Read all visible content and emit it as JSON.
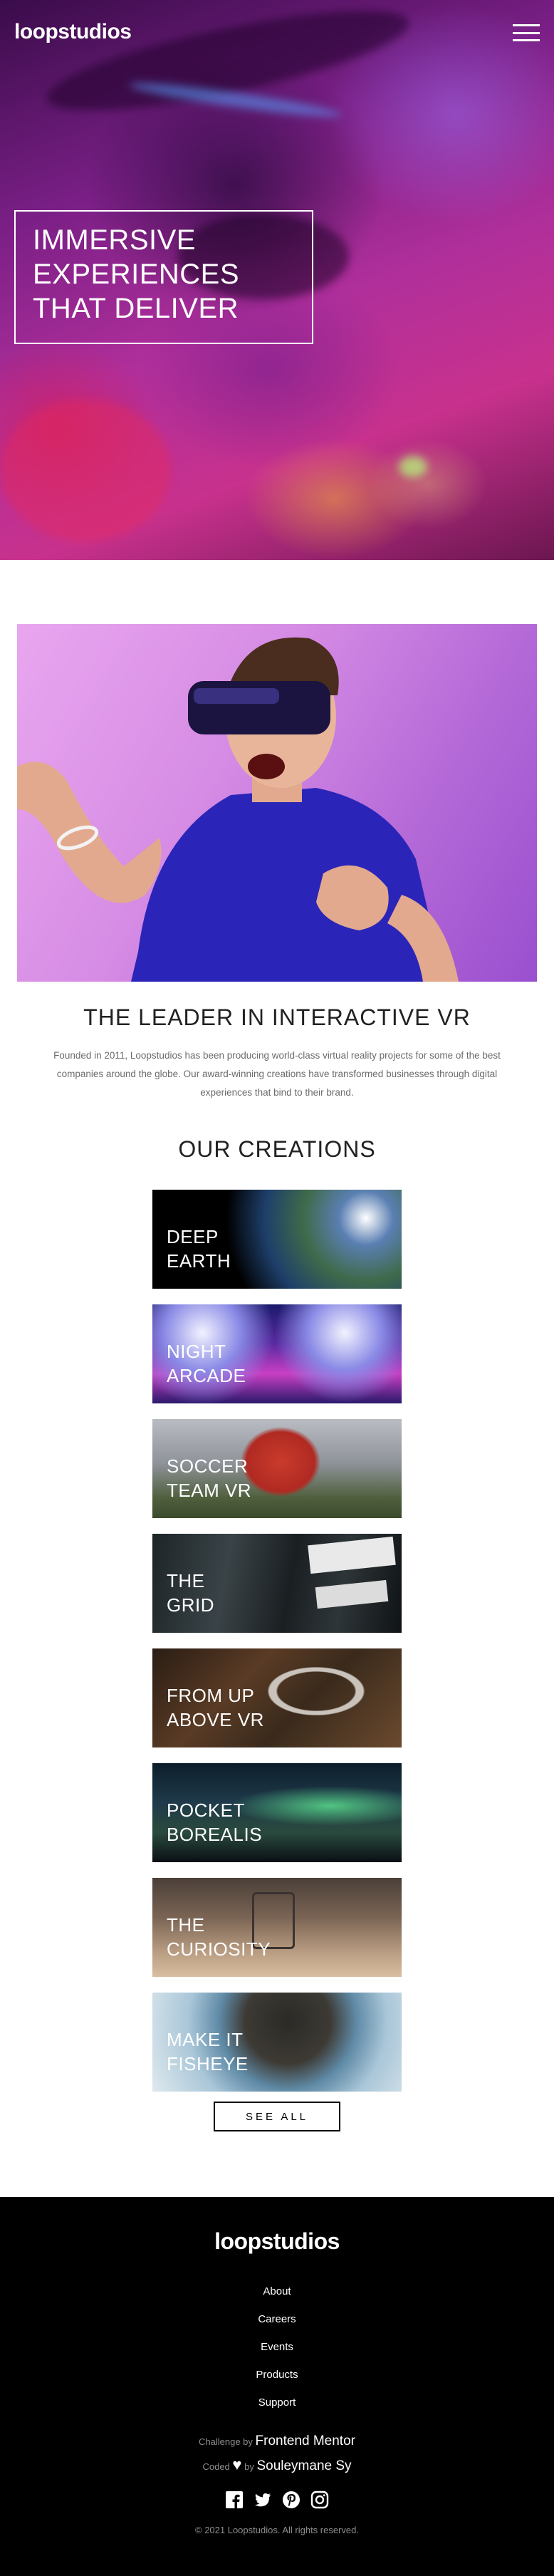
{
  "header": {
    "logo": "loopstudios",
    "menu_icon": "hamburger-menu-icon"
  },
  "hero": {
    "title": "IMMERSIVE\nEXPERIENCES\nTHAT DELIVER"
  },
  "intro": {
    "heading": "THE LEADER IN INTERACTIVE VR",
    "text": "Founded in 2011, Loopstudios has been producing world-class virtual reality projects for some of the best companies around the globe. Our award-winning creations have transformed businesses through digital experiences that bind to their brand."
  },
  "creations": {
    "heading": "OUR CREATIONS",
    "items": [
      {
        "title": "DEEP\nEARTH"
      },
      {
        "title": "NIGHT\nARCADE"
      },
      {
        "title": "SOCCER\nTEAM VR"
      },
      {
        "title": "THE\nGRID"
      },
      {
        "title": "FROM UP\nABOVE VR"
      },
      {
        "title": "POCKET\nBOREALIS"
      },
      {
        "title": "THE\nCURIOSITY"
      },
      {
        "title": "MAKE IT\nFISHEYE"
      }
    ],
    "see_all": "SEE ALL"
  },
  "footer": {
    "logo": "loopstudios",
    "nav": [
      "About",
      "Careers",
      "Events",
      "Products",
      "Support"
    ],
    "challenge_prefix": "Challenge by",
    "challenge_by": "Frontend Mentor",
    "coded_prefix": "Coded",
    "coded_heart": "♥",
    "coded_by": "by",
    "coded_name": "Souleymane Sy",
    "social": [
      "facebook-icon",
      "twitter-icon",
      "pinterest-icon",
      "instagram-icon"
    ],
    "copyright": "© 2021 Loopstudios. All rights reserved."
  }
}
